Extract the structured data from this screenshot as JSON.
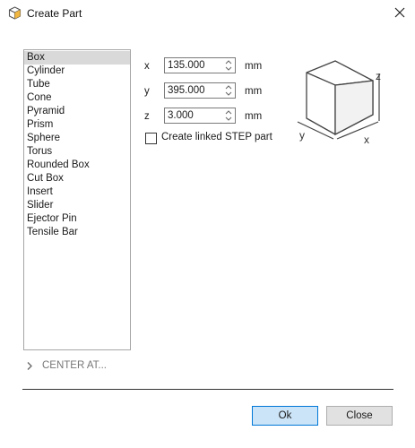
{
  "window": {
    "title": "Create Part"
  },
  "shapes": {
    "items": [
      "Box",
      "Cylinder",
      "Tube",
      "Cone",
      "Pyramid",
      "Prism",
      "Sphere",
      "Torus",
      "Rounded Box",
      "Cut Box",
      "Insert",
      "Slider",
      "Ejector Pin",
      "Tensile Bar"
    ],
    "selected": "Box"
  },
  "dimensions": {
    "x": {
      "label": "x",
      "value": "135.000",
      "unit": "mm"
    },
    "y": {
      "label": "y",
      "value": "395.000",
      "unit": "mm"
    },
    "z": {
      "label": "z",
      "value": "3.000",
      "unit": "mm"
    }
  },
  "linked_step": {
    "label": "Create linked STEP part",
    "checked": false
  },
  "diagram": {
    "x_label": "x",
    "y_label": "y",
    "z_label": "z"
  },
  "center_at": {
    "label": "CENTER AT..."
  },
  "buttons": {
    "ok": "Ok",
    "close": "Close"
  },
  "colors": {
    "ok_bg": "#cce4f7",
    "ok_border": "#0078d7",
    "selected_row": "#d9d9d9"
  },
  "icons": {
    "app": "cube-icon",
    "close": "close-icon",
    "expand": "chevron-right-icon",
    "spin": "spin-arrows-icon"
  }
}
